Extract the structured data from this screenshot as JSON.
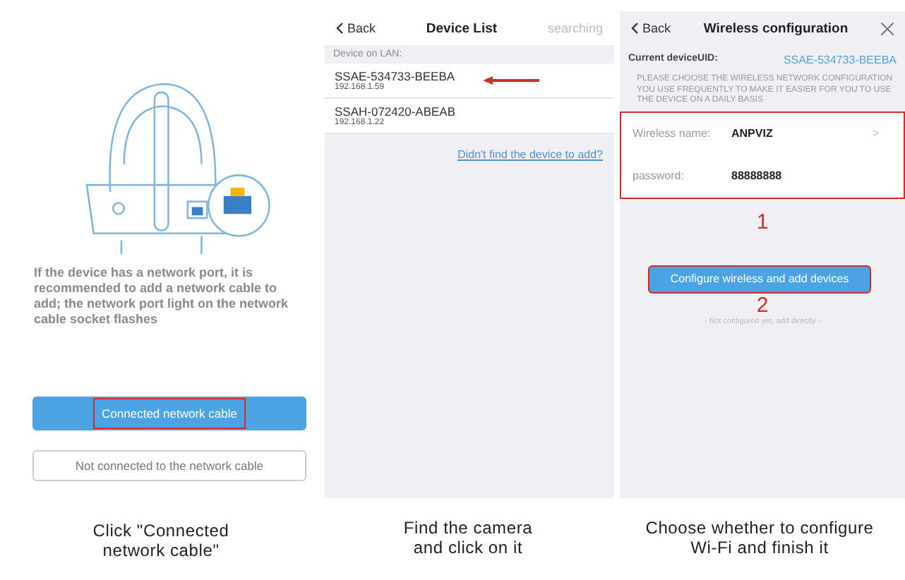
{
  "steps": [
    {
      "kind": "cable",
      "caption": "Click \"Connected network cable\"",
      "description": "If the device has a network port, it is recommended to add a network cable to add; the network port light on the network cable socket flashes",
      "buttons": [
        {
          "label": "Connected network cable",
          "primary": true,
          "highlighted": true
        },
        {
          "label": "Not connected to the network cable",
          "primary": false,
          "highlighted": false
        }
      ]
    },
    {
      "kind": "list",
      "caption": "Find the camera and click on it",
      "back": "Back",
      "title": "Device List",
      "status": "searching",
      "section": "Device on LAN:",
      "devices": [
        {
          "name": "SSAE-534733-BEEBA",
          "ip": "192.168.1.59",
          "pointed": true
        },
        {
          "name": "SSAH-072420-ABEAB",
          "ip": "192.168.1.22",
          "pointed": false
        }
      ],
      "link": "Didn't find the device to add?"
    },
    {
      "kind": "wifi",
      "caption": "Choose whether to configure Wi-Fi and finish it",
      "back": "Back",
      "title": "Wireless configuration",
      "uid_label": "Current deviceUID:",
      "uid": "SSAE-534733-BEEBA",
      "note": "PLEASE CHOOSE THE WIRELESS NETWORK CONFIGURATION YOU USE FREQUENTLY TO MAKE IT EASIER FOR YOU TO USE THE DEVICE ON A DAILY BASIS",
      "fields": [
        {
          "label": "Wireless name:",
          "value": "ANPVIZ",
          "chevron": ">"
        },
        {
          "label": "password:",
          "value": "88888888"
        }
      ],
      "marker_1": "1",
      "button": "Configure wireless and add devices",
      "marker_2": "2",
      "skip": "- Not configured yet, add directly -"
    }
  ]
}
